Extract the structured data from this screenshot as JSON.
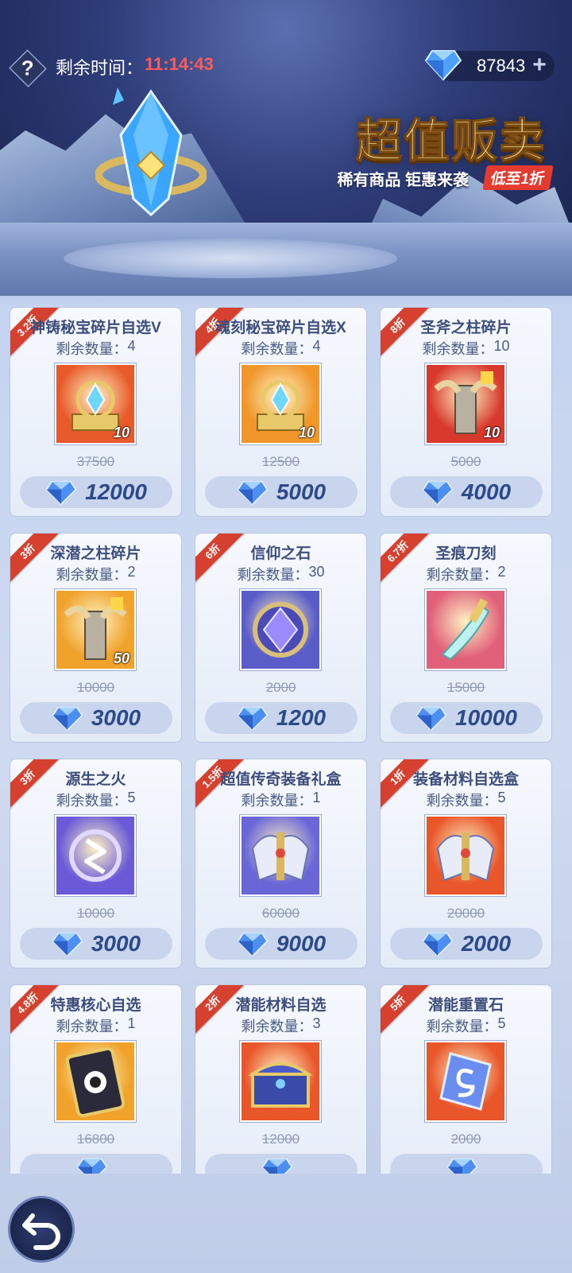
{
  "header": {
    "timer_label": "剩余时间：",
    "timer_value": "11:14:43",
    "currency_amount": "87843",
    "currency_icon": "gem-icon",
    "add_symbol": "+"
  },
  "promo": {
    "title": "超值贩卖",
    "subtitle": "稀有商品 钜惠来袭",
    "badge": "低至1折"
  },
  "colors": {
    "ribbon": "#d6412f",
    "timer": "#ff5a5a",
    "price": "#2d4a88"
  },
  "stock_label": "剩余数量：",
  "items": [
    {
      "discount": "3.2折",
      "name": "神铸秘宝碎片自选V",
      "stock": "4",
      "qty": "10",
      "original": "37500",
      "price": "12000",
      "bg": "#e85a2a",
      "icon": "orb-pedestal-icon"
    },
    {
      "discount": "4折",
      "name": "魂刻秘宝碎片自选X",
      "stock": "4",
      "qty": "10",
      "original": "12500",
      "price": "5000",
      "bg": "#f0962a",
      "icon": "orb-pedestal-icon"
    },
    {
      "discount": "8折",
      "name": "圣斧之柱碎片",
      "stock": "10",
      "qty": "10",
      "original": "5000",
      "price": "4000",
      "bg": "#d8392c",
      "icon": "pillar-icon"
    },
    {
      "discount": "3折",
      "name": "深潜之柱碎片",
      "stock": "2",
      "qty": "50",
      "original": "10000",
      "price": "3000",
      "bg": "#f0a22a",
      "icon": "pillar-icon"
    },
    {
      "discount": "6折",
      "name": "信仰之石",
      "stock": "30",
      "qty": "",
      "original": "2000",
      "price": "1200",
      "bg": "#5a5cc8",
      "icon": "faith-stone-icon"
    },
    {
      "discount": "6.7折",
      "name": "圣痕刀刻",
      "stock": "2",
      "qty": "",
      "original": "15000",
      "price": "10000",
      "bg": "#e0607a",
      "icon": "blade-icon"
    },
    {
      "discount": "3折",
      "name": "源生之火",
      "stock": "5",
      "qty": "",
      "original": "10000",
      "price": "3000",
      "bg": "#6a5ad8",
      "icon": "flame-rune-icon"
    },
    {
      "discount": "1.5折",
      "name": "超值传奇装备礼盒",
      "stock": "1",
      "qty": "",
      "original": "60000",
      "price": "9000",
      "bg": "#6a66d8",
      "icon": "armor-icon"
    },
    {
      "discount": "1折",
      "name": "装备材料自选盒",
      "stock": "5",
      "qty": "",
      "original": "20000",
      "price": "2000",
      "bg": "#e8562a",
      "icon": "armor-icon"
    },
    {
      "discount": "4.8折",
      "name": "特惠核心自选",
      "stock": "1",
      "qty": "",
      "original": "16800",
      "price": "",
      "bg": "#f0a22a",
      "icon": "core-card-icon"
    },
    {
      "discount": "2折",
      "name": "潜能材料自选",
      "stock": "3",
      "qty": "",
      "original": "12000",
      "price": "",
      "bg": "#e8562a",
      "icon": "chest-icon"
    },
    {
      "discount": "5折",
      "name": "潜能重置石",
      "stock": "5",
      "qty": "",
      "original": "2000",
      "price": "",
      "bg": "#e8562a",
      "icon": "reset-stone-icon"
    }
  ]
}
